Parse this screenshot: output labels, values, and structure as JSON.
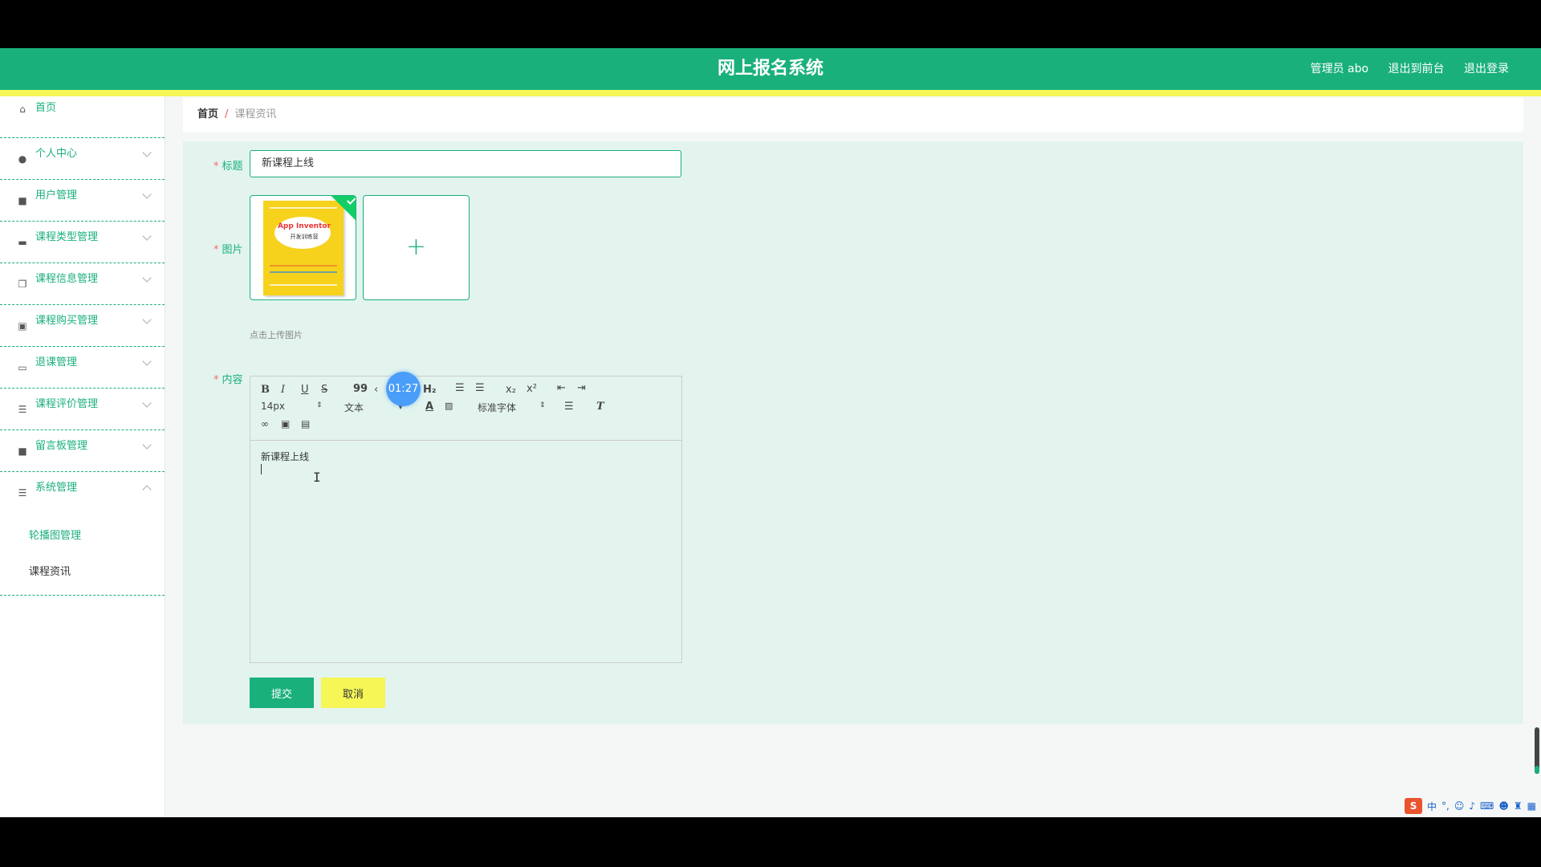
{
  "header": {
    "title": "网上报名系统",
    "user": "管理员 abo",
    "front_link": "退出到前台",
    "logout_link": "退出登录"
  },
  "sidebar": {
    "items": [
      {
        "label": "首页",
        "icon": "home-icon"
      },
      {
        "label": "个人中心",
        "icon": "user-icon"
      },
      {
        "label": "用户管理",
        "icon": "briefcase-icon"
      },
      {
        "label": "课程类型管理",
        "icon": "chat-icon"
      },
      {
        "label": "课程信息管理",
        "icon": "copy-icon"
      },
      {
        "label": "课程购买管理",
        "icon": "clipboard-icon"
      },
      {
        "label": "退课管理",
        "icon": "message-icon"
      },
      {
        "label": "课程评价管理",
        "icon": "list-icon"
      },
      {
        "label": "留言板管理",
        "icon": "briefcase-icon"
      },
      {
        "label": "系统管理",
        "icon": "sliders-icon"
      }
    ],
    "subitems": [
      "轮播图管理",
      "课程资讯"
    ]
  },
  "breadcrumb": {
    "home": "首页",
    "separator": "/",
    "current": "课程资讯"
  },
  "form": {
    "title_label": "标题",
    "title_value": "新课程上线",
    "image_label": "图片",
    "image_hint": "点击上传图片",
    "book_title": "App Inventor",
    "book_subtitle": "开发训练营",
    "content_label": "内容",
    "content_text": "新课程上线",
    "submit_label": "提交",
    "cancel_label": "取消"
  },
  "editor": {
    "font_size": "14px",
    "format": "文本",
    "font_family": "标准字体",
    "timer": "01:27",
    "h2": "H₂",
    "sub": "x₂",
    "sup": "x²",
    "quote": "99"
  },
  "ime": {
    "lang": "中",
    "punct": "°,"
  },
  "colors": {
    "accent": "#1ab07c",
    "yellow": "#f6f657",
    "panel": "#e3f4ee",
    "required": "#f56c6c"
  }
}
